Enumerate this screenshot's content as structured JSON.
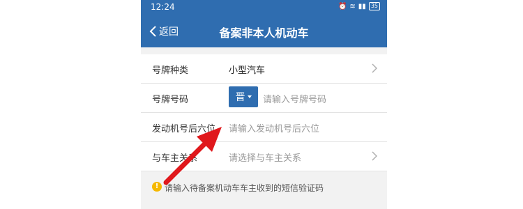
{
  "status_bar": {
    "time": "12:24",
    "battery": "35"
  },
  "navbar": {
    "back_label": "返回",
    "title": "备案非本人机动车"
  },
  "form": {
    "plate_type": {
      "label": "号牌种类",
      "value": "小型汽车"
    },
    "plate_number": {
      "label": "号牌号码",
      "province": "晋",
      "placeholder": "请输入号牌号码"
    },
    "engine_number": {
      "label": "发动机号后六位",
      "placeholder": "请输入发动机号后六位"
    },
    "relationship": {
      "label": "与车主关系",
      "placeholder": "请选择与车主关系"
    }
  },
  "hint": {
    "text": "请输入待备案机动车车主收到的短信验证码"
  },
  "colors": {
    "primary": "#2f6db0",
    "warning": "#f5b800",
    "annotation_arrow": "#e0181c"
  },
  "icons": [
    "alarm-icon",
    "wifi-icon",
    "signal-icon",
    "battery-icon",
    "back-chevron-icon",
    "chevron-right-icon",
    "caret-down-icon",
    "warning-icon",
    "annotation-arrow-icon"
  ]
}
